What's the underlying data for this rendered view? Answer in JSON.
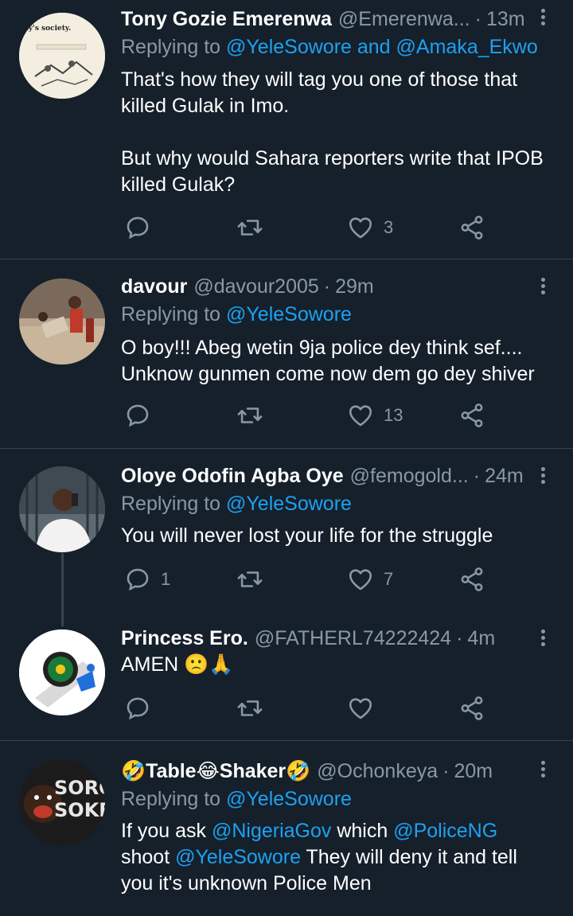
{
  "tweets": [
    {
      "name": "Tony Gozie Emerenwa",
      "handle": "@Emerenwa...",
      "sep": "·",
      "time": "13m",
      "replying_prefix": "Replying to ",
      "replying_a": "@YeleSowore",
      "replying_and": " and ",
      "replying_b": "@Amaka_Ekwo",
      "text_1": "That's how they will tag you one of those that killed Gulak in Imo.",
      "text_2": "But why would Sahara reporters write that IPOB killed Gulak?",
      "replies": "",
      "retweets": "",
      "likes": "3",
      "avatar_caption": "ay's society."
    },
    {
      "name": "davour",
      "handle": "@davour2005",
      "sep": "·",
      "time": "29m",
      "replying_prefix": "Replying to ",
      "replying_a": "@YeleSowore",
      "text_1": "O boy!!! Abeg wetin 9ja police dey think sef.... Unknow gunmen come now dem go dey shiver",
      "replies": "",
      "retweets": "",
      "likes": "13"
    },
    {
      "name": "Oloye Odofin Agba Oye",
      "handle": "@femogold...",
      "sep": "·",
      "time": "24m",
      "replying_prefix": "Replying to ",
      "replying_a": "@YeleSowore",
      "text_1": "You will never lost your life for the struggle",
      "replies": "1",
      "retweets": "",
      "likes": "7"
    },
    {
      "name": "Princess Ero.",
      "handle": "@FATHERL74222424",
      "sep": "·",
      "time": "4m",
      "text_1": "AMEN 🙁🙏",
      "replies": "",
      "retweets": "",
      "likes": ""
    },
    {
      "name": "🤣Table😂Shaker🤣",
      "handle": "@Ochonkeya",
      "sep": "·",
      "time": "20m",
      "replying_prefix": "Replying to ",
      "replying_a": "@YeleSowore",
      "t_if": "If you ask ",
      "t_m1": "@NigeriaGov",
      "t_which": " which ",
      "t_m2": "@PoliceNG",
      "t_shoot": " shoot ",
      "t_m3": "@YeleSowore",
      "t_rest": " They will deny it and tell you it's unknown Police Men",
      "avatar_text_1": "SORO",
      "avatar_text_2": "SOKE"
    }
  ],
  "colors": {
    "background": "#15202b",
    "text_primary": "#ffffff",
    "text_secondary": "#8899a6",
    "link": "#1da1f2",
    "divider": "#38444d"
  },
  "icons": [
    "reply-icon",
    "retweet-icon",
    "like-icon",
    "share-icon",
    "more-icon"
  ]
}
